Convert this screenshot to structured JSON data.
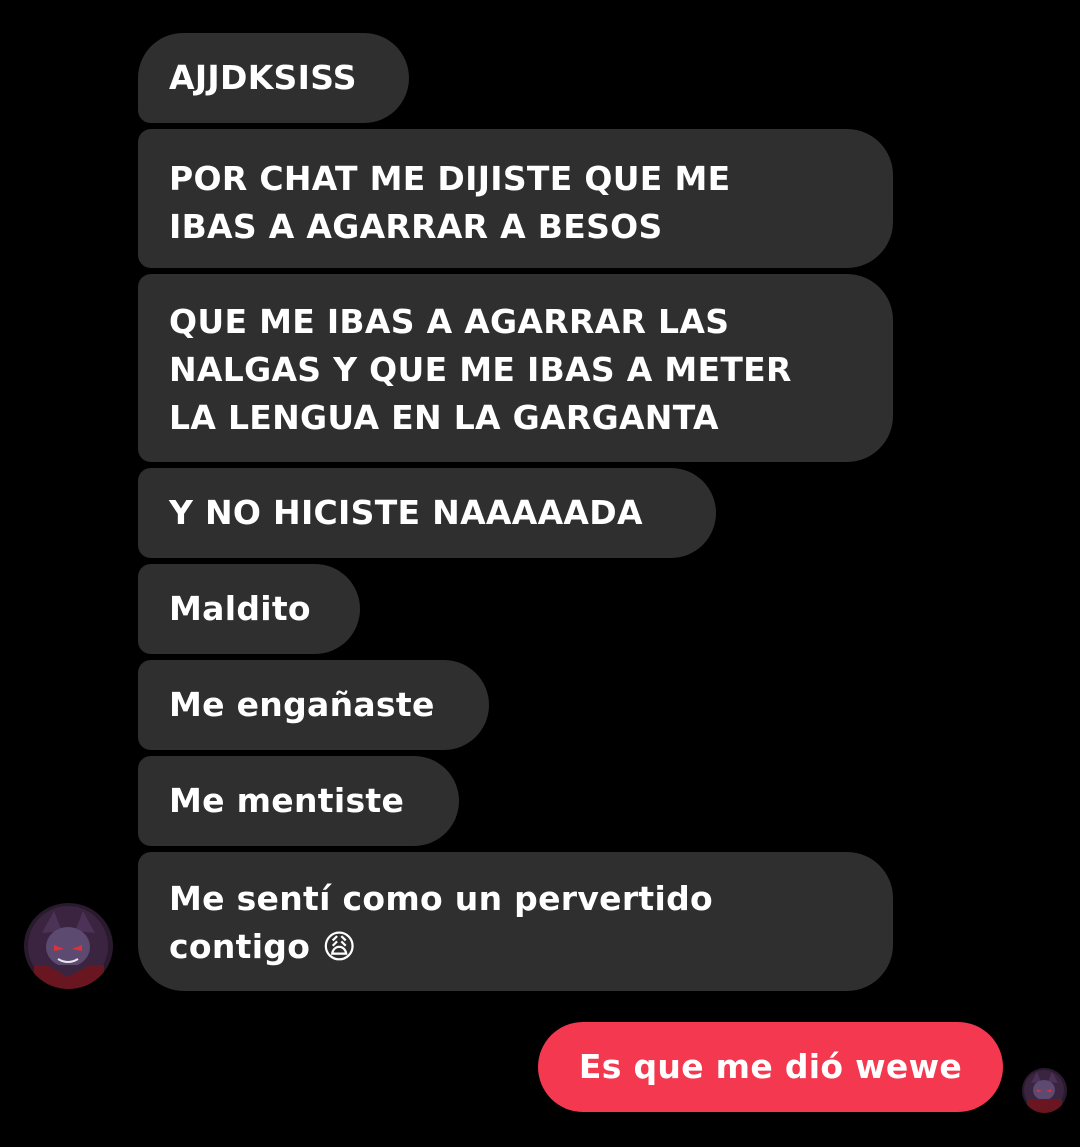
{
  "conversation": {
    "received": [
      {
        "lines": [
          "AJJDKSISS"
        ]
      },
      {
        "lines": [
          "POR CHAT ME DIJISTE QUE ME",
          "IBAS A AGARRAR A BESOS"
        ]
      },
      {
        "lines": [
          "QUE ME IBAS A AGARRAR LAS",
          "NALGAS Y QUE ME IBAS A METER",
          "LA LENGUA EN LA GARGANTA"
        ]
      },
      {
        "lines": [
          "Y NO HICISTE NAAAAADA"
        ]
      },
      {
        "lines": [
          "Maldito"
        ]
      },
      {
        "lines": [
          "Me engañaste"
        ]
      },
      {
        "lines": [
          "Me mentiste"
        ]
      },
      {
        "lines": [
          "Me sentí como un pervertido",
          "contigo 😩"
        ]
      }
    ],
    "sent": [
      {
        "text": "Es que me dió wewe"
      }
    ]
  },
  "colors": {
    "background": "#000000",
    "received_bubble": "#2f2f2f",
    "sent_bubble": "#f4384f",
    "text": "#ffffff"
  },
  "icons": {
    "contact_avatar": "contact-avatar-icon",
    "read_receipt_avatar": "read-receipt-avatar-icon"
  }
}
